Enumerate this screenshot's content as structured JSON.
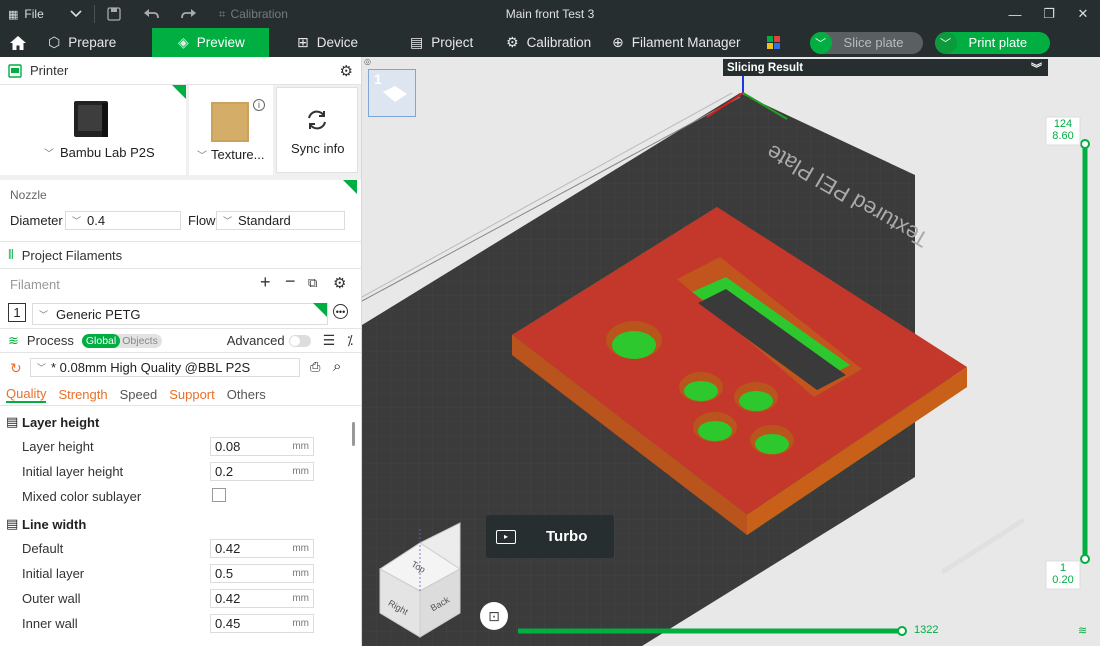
{
  "titlebar": {
    "file_label": "File",
    "calibration_label": "Calibration",
    "window_title": "Main front Test 3"
  },
  "nav": {
    "prepare": "Prepare",
    "preview": "Preview",
    "device": "Device",
    "project": "Project",
    "calibration": "Calibration",
    "filament_manager": "Filament Manager",
    "slice_plate": "Slice plate",
    "print_plate": "Print plate"
  },
  "printer": {
    "section_title": "Printer",
    "printer_name": "Bambu Lab P2S",
    "plate_name": "Texture...",
    "sync_label": "Sync info",
    "nozzle_label": "Nozzle",
    "diameter_label": "Diameter",
    "diameter_value": "0.4",
    "flow_label": "Flow",
    "flow_value": "Standard"
  },
  "filaments": {
    "section_title": "Project Filaments",
    "filament_label": "Filament",
    "slot_number": "1",
    "filament_name": "Generic PETG"
  },
  "process": {
    "section_title": "Process",
    "toggle_global": "Global",
    "toggle_objects": "Objects",
    "advanced_label": "Advanced",
    "preset_name": "* 0.08mm High Quality @BBL P2S",
    "tabs": [
      "Quality",
      "Strength",
      "Speed",
      "Support",
      "Others"
    ],
    "groups": [
      {
        "title": "Layer height",
        "params": [
          {
            "label": "Layer height",
            "value": "0.08",
            "unit": "mm"
          },
          {
            "label": "Initial layer height",
            "value": "0.2",
            "unit": "mm"
          },
          {
            "label": "Mixed color sublayer",
            "value": "",
            "unit": ""
          }
        ]
      },
      {
        "title": "Line width",
        "params": [
          {
            "label": "Default",
            "value": "0.42",
            "unit": "mm"
          },
          {
            "label": "Initial layer",
            "value": "0.5",
            "unit": "mm"
          },
          {
            "label": "Outer wall",
            "value": "0.42",
            "unit": "mm"
          },
          {
            "label": "Inner wall",
            "value": "0.45",
            "unit": "mm"
          }
        ]
      }
    ]
  },
  "viewport": {
    "slicing_result_label": "Slicing Result",
    "plate_number": "1",
    "turbo_label": "Turbo",
    "layer_top": "124",
    "height_top": "8.60",
    "layer_bottom": "1",
    "height_bottom": "0.20",
    "horizontal_value": "1322",
    "bed_text": "Textured PEI Plate",
    "cube_top": "Top",
    "cube_right": "Right",
    "cube_back": "Back"
  },
  "colors": {
    "accent": "#00ae42",
    "model_red": "#c4372b",
    "bed_dark": "#3b3b3b",
    "titlebar": "#262e30"
  }
}
